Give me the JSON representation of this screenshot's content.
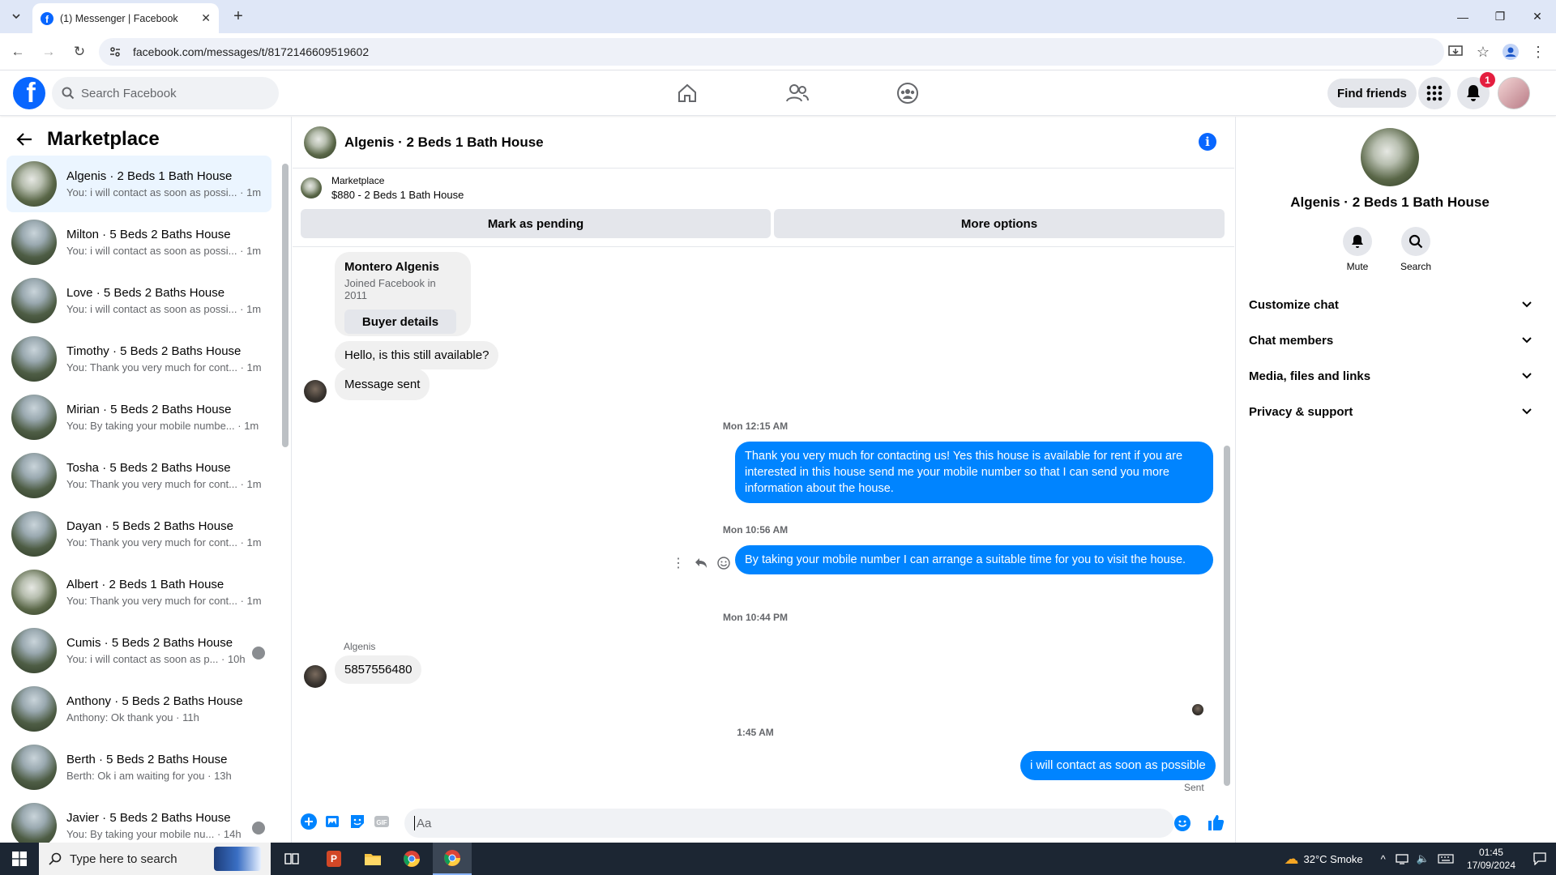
{
  "browser": {
    "tab_title": "(1) Messenger | Facebook",
    "url": "facebook.com/messages/t/8172146609519602"
  },
  "fb_header": {
    "search_placeholder": "Search Facebook",
    "find_friends": "Find friends",
    "notification_count": "1"
  },
  "sidebar": {
    "title": "Marketplace",
    "conversations": [
      {
        "name": "Algenis · 2 Beds 1 Bath House",
        "snippet": "You: i will contact as soon as possi... · 1m",
        "active": true
      },
      {
        "name": "Milton · 5 Beds 2 Baths House",
        "snippet": "You: i will contact as soon as possi... · 1m"
      },
      {
        "name": "Love · 5 Beds 2 Baths House",
        "snippet": "You: i will contact as soon as possi... · 1m"
      },
      {
        "name": "Timothy · 5 Beds 2 Baths House",
        "snippet": "You: Thank you very much for cont... · 1m"
      },
      {
        "name": "Mirian · 5 Beds 2 Baths House",
        "snippet": "You: By taking your mobile numbe... · 1m"
      },
      {
        "name": "Tosha · 5 Beds 2 Baths House",
        "snippet": "You: Thank you very much for cont... · 1m"
      },
      {
        "name": "Dayan · 5 Beds 2 Baths House",
        "snippet": "You: Thank you very much for cont... · 1m"
      },
      {
        "name": "Albert · 2 Beds 1 Bath House",
        "snippet": "You: Thank you very much for cont... · 1m"
      },
      {
        "name": "Cumis · 5 Beds 2 Baths House",
        "snippet": "You: i will contact as soon as p... · 10h"
      },
      {
        "name": "Anthony · 5 Beds 2 Baths House",
        "snippet": "Anthony: Ok thank you · 11h"
      },
      {
        "name": "Berth · 5 Beds 2 Baths House",
        "snippet": "Berth: Ok i am waiting for you · 13h"
      },
      {
        "name": "Javier · 5 Beds 2 Baths House",
        "snippet": "You: By taking your mobile nu... · 14h"
      }
    ]
  },
  "chat": {
    "title": "Algenis · 2 Beds 1 Bath House",
    "marketplace_label": "Marketplace",
    "listing": "$880 - 2 Beds 1 Bath House",
    "mark_pending": "Mark as pending",
    "more_options": "More options",
    "profile_name": "Montero Algenis",
    "profile_joined": "Joined Facebook in 2011",
    "buyer_details": "Buyer details",
    "msg_in_1": "Hello, is this still available?",
    "msg_in_2": "Message sent",
    "ts_1": "Mon 12:15 AM",
    "msg_out_1": "Thank you very much for contacting us! Yes this house is available for rent if you are interested in this house send me your mobile number so that I can send you more information about the house.",
    "ts_2": "Mon 10:56 AM",
    "msg_out_2": "By taking your mobile number I can arrange a suitable time for you to visit the house.",
    "ts_3": "Mon 10:44 PM",
    "sender_label": "Algenis",
    "msg_in_3": "5857556480",
    "ts_4": "1:45 AM",
    "msg_out_3": "i will contact as soon as possible",
    "sent_status": "Sent",
    "composer_placeholder": "Aa"
  },
  "right_panel": {
    "name": "Algenis · 2 Beds 1 Bath House",
    "mute": "Mute",
    "search": "Search",
    "sections": [
      "Customize chat",
      "Chat members",
      "Media, files and links",
      "Privacy & support"
    ]
  },
  "taskbar": {
    "search_placeholder": "Type here to search",
    "weather": "32°C  Smoke",
    "time": "01:45",
    "date": "17/09/2024"
  }
}
